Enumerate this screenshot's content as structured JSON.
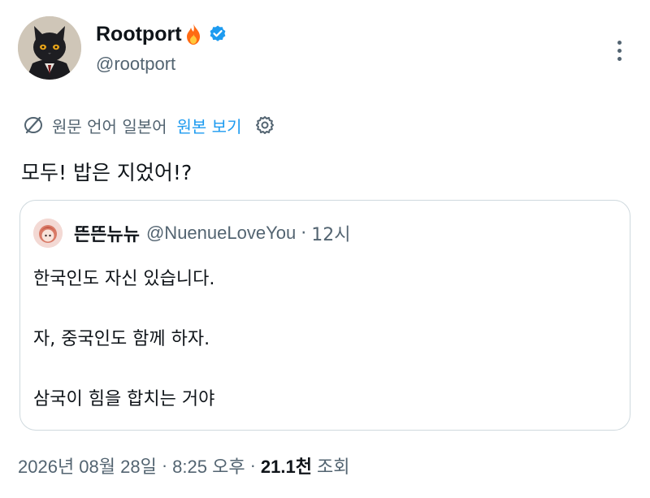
{
  "author": {
    "display_name": "Rootport",
    "handle": "@rootport"
  },
  "translation": {
    "label": "원문 언어 일본어",
    "show_original": "원본 보기"
  },
  "tweet": {
    "text": "모두! 밥은 지었어!?"
  },
  "quote": {
    "display_name": "뜬뜬뉴뉴",
    "handle": "@NuenueLoveYou",
    "separator": "·",
    "time": "12시",
    "lines": [
      "한국인도 자신 있습니다.",
      "자, 중국인도 함께 하자.",
      "삼국이 힘을 합치는 거야"
    ]
  },
  "meta": {
    "date": "2026년 08월 28일",
    "separator": "·",
    "time": "8:25 오후",
    "views_count": "21.1천",
    "views_label": "조회"
  },
  "colors": {
    "text": "#0f1419",
    "secondary": "#536471",
    "accent": "#1d9bf0",
    "border": "#cfd9de",
    "fire": "#ff6a13"
  },
  "icons": [
    "fire-icon",
    "verified-icon",
    "more-icon",
    "translate-icon",
    "gear-icon"
  ]
}
